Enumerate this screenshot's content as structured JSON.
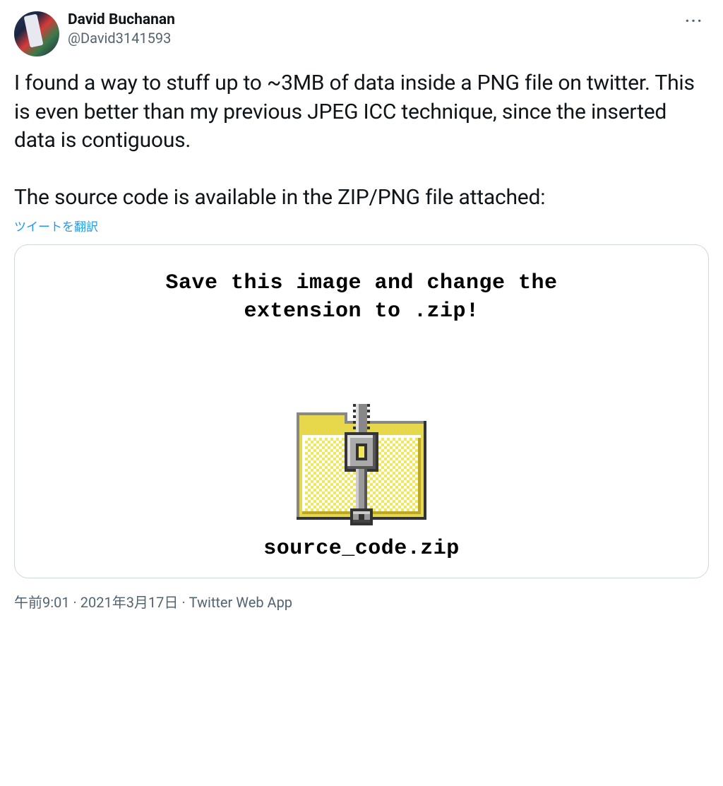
{
  "header": {
    "display_name": "David Buchanan",
    "handle": "@David3141593",
    "more_label": "···"
  },
  "body": {
    "text": "I found a way to stuff up to ~3MB of data inside a PNG file on twitter. This is even better than my previous JPEG ICC technique, since the inserted data is contiguous.\n\nThe source code is available in the ZIP/PNG file attached:"
  },
  "translate_label": "ツイートを翻訳",
  "media": {
    "instruction": "Save this image and change the\nextension to .zip!",
    "filename": "source_code.zip"
  },
  "meta": {
    "time": "午前9:01",
    "sep1": " · ",
    "date": "2021年3月17日",
    "sep2": " · ",
    "source": "Twitter Web App"
  }
}
